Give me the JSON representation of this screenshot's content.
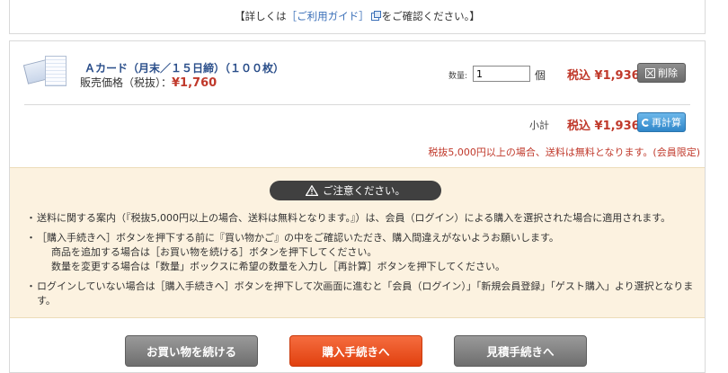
{
  "top_notice": {
    "before": "【詳しくは",
    "link": "［ご利用ガイド］",
    "after": "をご確認ください。】"
  },
  "item": {
    "name": "Ａカード（月末／１５日締）（１００枚）",
    "price_label": "販売価格（税抜）：",
    "price": "¥1,760",
    "qty_label": "数量:",
    "qty_value": "1",
    "qty_unit": "個",
    "line_total": "税込 ¥1,936",
    "delete_label": "削除"
  },
  "subtotal": {
    "label": "小計",
    "value": "税込 ¥1,936",
    "recalc_label": "再計算"
  },
  "free_shipping_note": "税抜5,000円以上の場合、送料は無料となります。(会員限定)",
  "caution": {
    "title": "ご注意ください。",
    "notes": [
      "送料に関する案内（『税抜5,000円以上の場合、送料は無料となります。』）は、会員（ログイン）による購入を選択された場合に適用されます。",
      "［購入手続きへ］ボタンを押下する前に『買い物かご』の中をご確認いただき、購入間違えがないようお願いします。",
      "商品を追加する場合は［お買い物を続ける］ボタンを押下してください。",
      "数量を変更する場合は「数量」ボックスに希望の数量を入力し［再計算］ボタンを押下してください。",
      "ログインしていない場合は［購入手続きへ］ボタンを押下して次画面に進むと「会員（ログイン）」「新規会員登録」「ゲスト購入」より選択となります。"
    ]
  },
  "buttons": {
    "continue": "お買い物を続ける",
    "checkout": "購入手続きへ",
    "estimate": "見積手続きへ"
  },
  "colors": {
    "price": "#c0392b",
    "link": "#3a6fb8",
    "notice_bg": "#fcf2e0",
    "checkout": "#ef5a25"
  }
}
